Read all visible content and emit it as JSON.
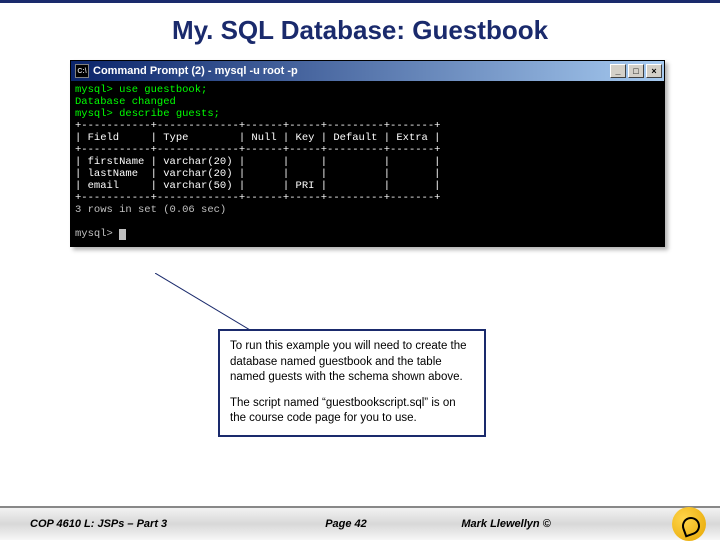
{
  "title": "My. SQL Database: Guestbook",
  "cmd": {
    "icon_label": "C:\\",
    "window_title": "Command Prompt (2) - mysql -u root -p",
    "minimize": "_",
    "maximize": "□",
    "close": "×",
    "line01": "mysql> use guestbook;",
    "line02": "Database changed",
    "line03": "mysql> describe guests;",
    "border": "+-----------+-------------+------+-----+---------+-------+",
    "header": "| Field     | Type        | Null | Key | Default | Extra |",
    "row1": "| firstName | varchar(20) |      |     |         |       |",
    "row2": "| lastName  | varchar(20) |      |     |         |       |",
    "row3": "| email     | varchar(50) |      | PRI |         |       |",
    "result": "3 rows in set (0.06 sec)",
    "prompt": "mysql> "
  },
  "info": {
    "p1": "To run this example you will need to create the database named guestbook and the table named guests with the schema shown above.",
    "p2": "The script named “guestbookscript.sql” is on the course code page for you to use."
  },
  "footer": {
    "left": "COP 4610 L: JSPs – Part 3",
    "center": "Page 42",
    "right": "Mark Llewellyn ©"
  }
}
